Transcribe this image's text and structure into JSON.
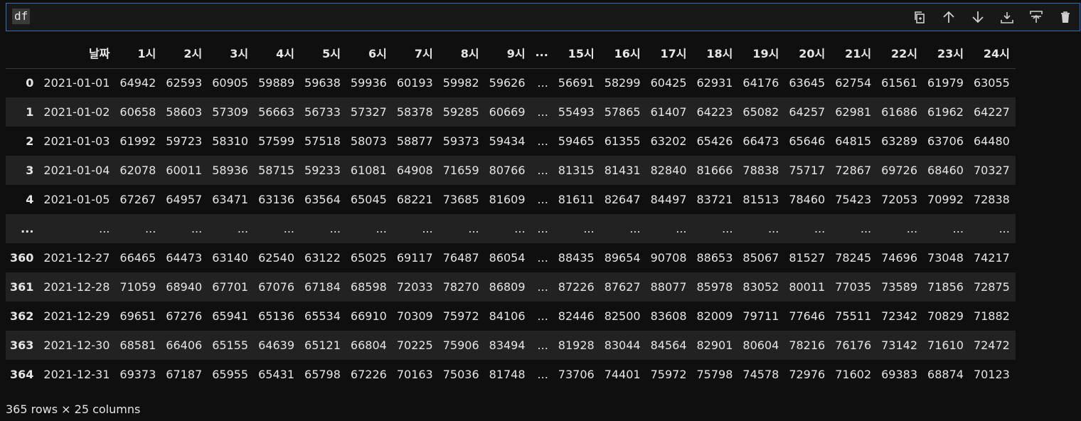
{
  "cell": {
    "code": "df",
    "toolbar": [
      {
        "name": "copy-icon"
      },
      {
        "name": "arrow-up-icon"
      },
      {
        "name": "arrow-down-icon"
      },
      {
        "name": "insert-below-icon"
      },
      {
        "name": "insert-above-icon"
      },
      {
        "name": "trash-icon"
      }
    ]
  },
  "table": {
    "columns": [
      "",
      "날짜",
      "1시",
      "2시",
      "3시",
      "4시",
      "5시",
      "6시",
      "7시",
      "8시",
      "9시",
      "...",
      "15시",
      "16시",
      "17시",
      "18시",
      "19시",
      "20시",
      "21시",
      "22시",
      "23시",
      "24시"
    ],
    "rows": [
      [
        "0",
        "2021-01-01",
        "64942",
        "62593",
        "60905",
        "59889",
        "59638",
        "59936",
        "60193",
        "59982",
        "59626",
        "...",
        "56691",
        "58299",
        "60425",
        "62931",
        "64176",
        "63645",
        "62754",
        "61561",
        "61979",
        "63055"
      ],
      [
        "1",
        "2021-01-02",
        "60658",
        "58603",
        "57309",
        "56663",
        "56733",
        "57327",
        "58378",
        "59285",
        "60669",
        "...",
        "55493",
        "57865",
        "61407",
        "64223",
        "65082",
        "64257",
        "62981",
        "61686",
        "61962",
        "64227"
      ],
      [
        "2",
        "2021-01-03",
        "61992",
        "59723",
        "58310",
        "57599",
        "57518",
        "58073",
        "58877",
        "59373",
        "59434",
        "...",
        "59465",
        "61355",
        "63202",
        "65426",
        "66473",
        "65646",
        "64815",
        "63289",
        "63706",
        "64480"
      ],
      [
        "3",
        "2021-01-04",
        "62078",
        "60011",
        "58936",
        "58715",
        "59233",
        "61081",
        "64908",
        "71659",
        "80766",
        "...",
        "81315",
        "81431",
        "82840",
        "81666",
        "78838",
        "75717",
        "72867",
        "69726",
        "68460",
        "70327"
      ],
      [
        "4",
        "2021-01-05",
        "67267",
        "64957",
        "63471",
        "63136",
        "63564",
        "65045",
        "68221",
        "73685",
        "81609",
        "...",
        "81611",
        "82647",
        "84497",
        "83721",
        "81513",
        "78460",
        "75423",
        "72053",
        "70992",
        "72838"
      ],
      [
        "...",
        "...",
        "...",
        "...",
        "...",
        "...",
        "...",
        "...",
        "...",
        "...",
        "...",
        "...",
        "...",
        "...",
        "...",
        "...",
        "...",
        "...",
        "...",
        "...",
        "...",
        "..."
      ],
      [
        "360",
        "2021-12-27",
        "66465",
        "64473",
        "63140",
        "62540",
        "63122",
        "65025",
        "69117",
        "76487",
        "86054",
        "...",
        "88435",
        "89654",
        "90708",
        "88653",
        "85067",
        "81527",
        "78245",
        "74696",
        "73048",
        "74217"
      ],
      [
        "361",
        "2021-12-28",
        "71059",
        "68940",
        "67701",
        "67076",
        "67184",
        "68598",
        "72033",
        "78270",
        "86809",
        "...",
        "87226",
        "87627",
        "88077",
        "85978",
        "83052",
        "80011",
        "77035",
        "73589",
        "71856",
        "72875"
      ],
      [
        "362",
        "2021-12-29",
        "69651",
        "67276",
        "65941",
        "65136",
        "65534",
        "66910",
        "70309",
        "75972",
        "84106",
        "...",
        "82446",
        "82500",
        "83608",
        "82009",
        "79711",
        "77646",
        "75511",
        "72342",
        "70829",
        "71882"
      ],
      [
        "363",
        "2021-12-30",
        "68581",
        "66406",
        "65155",
        "64639",
        "65121",
        "66804",
        "70225",
        "75906",
        "83494",
        "...",
        "81928",
        "83044",
        "84564",
        "82901",
        "80604",
        "78216",
        "76176",
        "73142",
        "71610",
        "72472"
      ],
      [
        "364",
        "2021-12-31",
        "69373",
        "67187",
        "65955",
        "65431",
        "65798",
        "67226",
        "70163",
        "75036",
        "81748",
        "...",
        "73706",
        "74401",
        "75972",
        "75798",
        "74578",
        "72976",
        "71602",
        "69383",
        "68874",
        "70123"
      ]
    ]
  },
  "footer": "365 rows × 25 columns"
}
